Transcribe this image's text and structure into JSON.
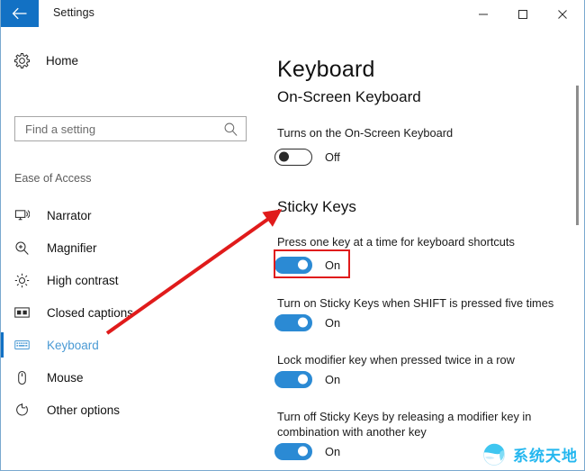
{
  "window": {
    "title": "Settings",
    "back_icon": "back-arrow-icon",
    "controls": [
      {
        "name": "minimize",
        "glyph": "minimize-icon"
      },
      {
        "name": "maximize",
        "glyph": "maximize-icon"
      },
      {
        "name": "close",
        "glyph": "close-icon"
      }
    ]
  },
  "sidebar": {
    "home": {
      "label": "Home",
      "icon": "gear-icon"
    },
    "search": {
      "value": "",
      "placeholder": "Find a setting",
      "icon": "search-icon"
    },
    "section_header": "Ease of Access",
    "items": [
      {
        "label": "Narrator",
        "icon": "narrator-icon",
        "selected": false
      },
      {
        "label": "Magnifier",
        "icon": "magnifier-icon",
        "selected": false
      },
      {
        "label": "High contrast",
        "icon": "high-contrast-icon",
        "selected": false
      },
      {
        "label": "Closed captions",
        "icon": "closed-captions-icon",
        "selected": false
      },
      {
        "label": "Keyboard",
        "icon": "keyboard-icon",
        "selected": true
      },
      {
        "label": "Mouse",
        "icon": "mouse-icon",
        "selected": false
      },
      {
        "label": "Other options",
        "icon": "other-options-icon",
        "selected": false
      }
    ]
  },
  "main": {
    "page_title": "Keyboard",
    "groups": [
      {
        "title": "On-Screen Keyboard",
        "settings": [
          {
            "description": "Turns on the On-Screen Keyboard",
            "state": "off",
            "state_label": "Off"
          }
        ]
      },
      {
        "title": "Sticky Keys",
        "settings": [
          {
            "description": "Press one key at a time for keyboard shortcuts",
            "state": "on",
            "state_label": "On"
          },
          {
            "description": "Turn on Sticky Keys when SHIFT is pressed five times",
            "state": "on",
            "state_label": "On"
          },
          {
            "description": "Lock modifier key when pressed twice in a row",
            "state": "on",
            "state_label": "On"
          },
          {
            "description": "Turn off Sticky Keys by releasing a modifier key in combination with another key",
            "state": "on",
            "state_label": "On"
          }
        ]
      }
    ]
  },
  "annotations": {
    "arrow": {
      "color": "#e01b1b",
      "points_to": "Sticky Keys"
    },
    "highlight": {
      "color": "#e01b1b",
      "target": "press-one-key-toggle"
    }
  },
  "watermark": {
    "text": "系统天地",
    "color": "#24b7ef",
    "logo": "globe-icon"
  },
  "colors": {
    "accent": "#1271c4",
    "toggle_on": "#2b8ad4",
    "selected_text": "#4a9ad4",
    "annotation_red": "#e01b1b"
  }
}
